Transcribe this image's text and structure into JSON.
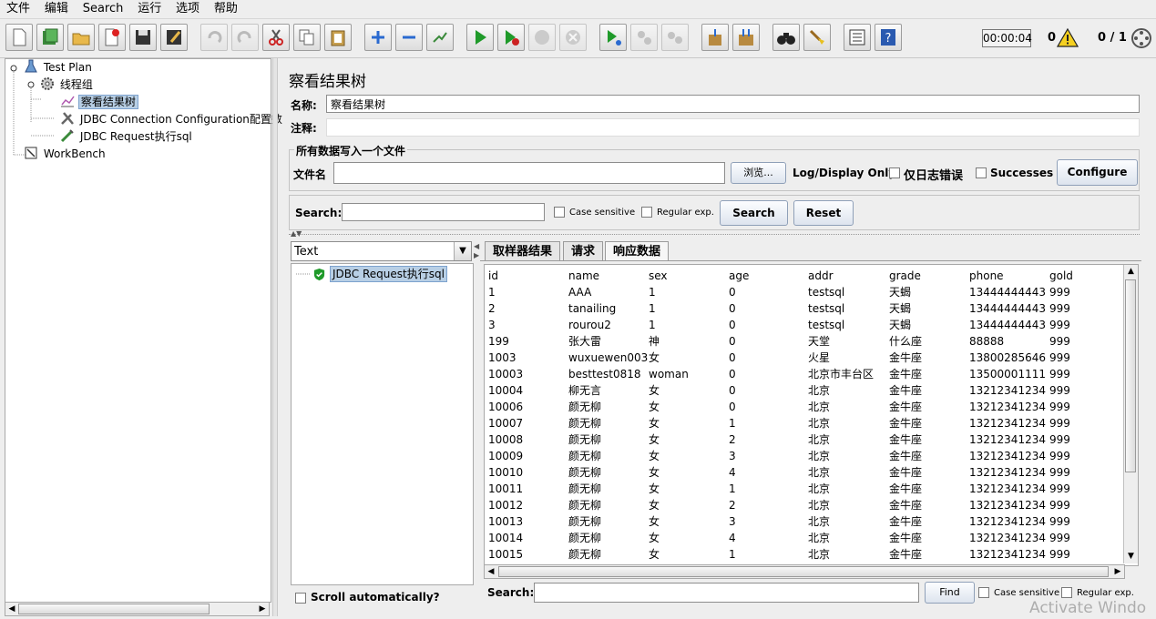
{
  "menu": [
    "文件",
    "编辑",
    "Search",
    "运行",
    "选项",
    "帮助"
  ],
  "toolbar": {
    "timer": "00:00:04",
    "warnings": "0",
    "threads": "0 / 1"
  },
  "tree": {
    "test_plan": "Test Plan",
    "thread_group": "线程组",
    "result_tree": "察看结果树",
    "jdbc_config": "JDBC Connection Configuration配置数",
    "jdbc_request": "JDBC Request执行sql",
    "workbench": "WorkBench"
  },
  "panel": {
    "title": "察看结果树",
    "name_label": "名称:",
    "name_value": "察看结果树",
    "comment_label": "注释:",
    "file_group_label": "所有数据写入一个文件",
    "filename_label": "文件名",
    "browse_label": "浏览...",
    "log_display_label": "Log/Display Only:",
    "errors_only_label": "仅日志错误",
    "successes_label": "Successes",
    "configure_label": "Configure"
  },
  "search": {
    "label": "Search:",
    "case_label": "Case sensitive",
    "regex_label": "Regular exp.",
    "search_button": "Search",
    "reset_button": "Reset"
  },
  "results": {
    "renderer": "Text",
    "sample": "JDBC Request执行sql",
    "scroll_label": "Scroll automatically?"
  },
  "tabs": [
    "取样器结果",
    "请求",
    "响应数据"
  ],
  "table": {
    "headers": [
      "id",
      "name",
      "sex",
      "age",
      "addr",
      "grade",
      "phone",
      "gold"
    ],
    "rows": [
      [
        "1",
        "AAA",
        "1",
        "0",
        "testsql",
        "天蝎",
        "13444444443",
        "999"
      ],
      [
        "2",
        "tanailing",
        "1",
        "0",
        "testsql",
        "天蝎",
        "13444444443",
        "999"
      ],
      [
        "3",
        "rourou2",
        "1",
        "0",
        "testsql",
        "天蝎",
        "13444444443",
        "999"
      ],
      [
        "199",
        "张大雷",
        "神",
        "0",
        "天堂",
        "什么座",
        "88888",
        "999"
      ],
      [
        "1003",
        "wuxuewen003",
        "女",
        "0",
        "火星",
        "金牛座",
        "13800285646",
        "999"
      ],
      [
        "10003",
        "besttest0818",
        "woman",
        "0",
        "北京市丰台区",
        "金牛座",
        "13500001111",
        "999"
      ],
      [
        "10004",
        "柳无言",
        "女",
        "0",
        "北京",
        "金牛座",
        "13212341234",
        "999"
      ],
      [
        "10006",
        "颜无柳",
        "女",
        "0",
        "北京",
        "金牛座",
        "13212341234",
        "999"
      ],
      [
        "10007",
        "颜无柳",
        "女",
        "1",
        "北京",
        "金牛座",
        "13212341234",
        "999"
      ],
      [
        "10008",
        "颜无柳",
        "女",
        "2",
        "北京",
        "金牛座",
        "13212341234",
        "999"
      ],
      [
        "10009",
        "颜无柳",
        "女",
        "3",
        "北京",
        "金牛座",
        "13212341234",
        "999"
      ],
      [
        "10010",
        "颜无柳",
        "女",
        "4",
        "北京",
        "金牛座",
        "13212341234",
        "999"
      ],
      [
        "10011",
        "颜无柳",
        "女",
        "1",
        "北京",
        "金牛座",
        "13212341234",
        "999"
      ],
      [
        "10012",
        "颜无柳",
        "女",
        "2",
        "北京",
        "金牛座",
        "13212341234",
        "999"
      ],
      [
        "10013",
        "颜无柳",
        "女",
        "3",
        "北京",
        "金牛座",
        "13212341234",
        "999"
      ],
      [
        "10014",
        "颜无柳",
        "女",
        "4",
        "北京",
        "金牛座",
        "13212341234",
        "999"
      ],
      [
        "10015",
        "颜无柳",
        "女",
        "1",
        "北京",
        "金牛座",
        "13212341234",
        "999"
      ]
    ]
  },
  "bottom_search": {
    "label": "Search:",
    "find_button": "Find",
    "case_label": "Case sensitive",
    "regex_label": "Regular exp."
  },
  "watermark": "Activate Windo"
}
